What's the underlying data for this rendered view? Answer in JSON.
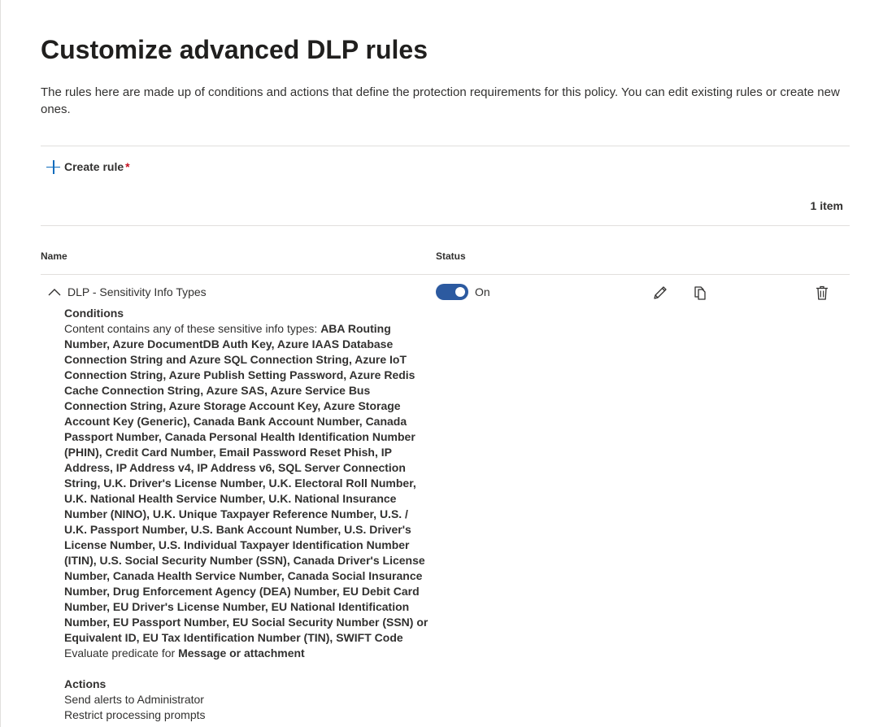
{
  "page": {
    "title": "Customize advanced DLP rules",
    "description": "The rules here are made up of conditions and actions that define the protection requirements for this policy. You can edit existing rules or create new ones."
  },
  "toolbar": {
    "create_rule_label": "Create rule",
    "required_marker": "*",
    "item_count": "1 item"
  },
  "table": {
    "columns": [
      "Name",
      "Status"
    ],
    "rows": [
      {
        "name": "DLP - Sensitivity Info Types",
        "status": "On",
        "enabled": true,
        "conditions_heading": "Conditions",
        "conditions_prefix": "Content contains any of these sensitive info types:",
        "info_types": "ABA Routing Number, Azure DocumentDB Auth Key, Azure IAAS Database Connection String and Azure SQL Connection String, Azure IoT Connection String, Azure Publish Setting Password, Azure Redis Cache Connection String, Azure SAS, Azure Service Bus Connection String, Azure Storage Account Key, Azure Storage Account Key (Generic), Canada Bank Account Number, Canada Passport Number, Canada Personal Health Identification Number (PHIN), Credit Card Number, Email Password Reset Phish, IP Address, IP Address v4, IP Address v6, SQL Server Connection String, U.K. Driver's License Number, U.K. Electoral Roll Number, U.K. National Health Service Number, U.K. National Insurance Number (NINO), U.K. Unique Taxpayer Reference Number, U.S. / U.K. Passport Number, U.S. Bank Account Number, U.S. Driver's License Number, U.S. Individual Taxpayer Identification Number (ITIN), U.S. Social Security Number (SSN), Canada Driver's License Number, Canada Health Service Number, Canada Social Insurance Number, Drug Enforcement Agency (DEA) Number, EU Debit Card Number, EU Driver's License Number, EU National Identification Number, EU Passport Number, EU Social Security Number (SSN) or Equivalent ID, EU Tax Identification Number (TIN), SWIFT Code",
        "predicate_prefix": "Evaluate predicate for",
        "predicate_value": "Message or attachment",
        "actions_heading": "Actions",
        "actions": [
          "Send alerts to Administrator",
          "Restrict processing prompts"
        ]
      }
    ]
  },
  "icons": {
    "create": "plus-icon",
    "collapse": "chevron-up-icon",
    "edit": "pencil-icon",
    "copy": "copy-icon",
    "delete": "trash-icon"
  },
  "colors": {
    "accent": "#0f6cbd",
    "toggle_on": "#2c5aa0",
    "required": "#c50f1f"
  }
}
